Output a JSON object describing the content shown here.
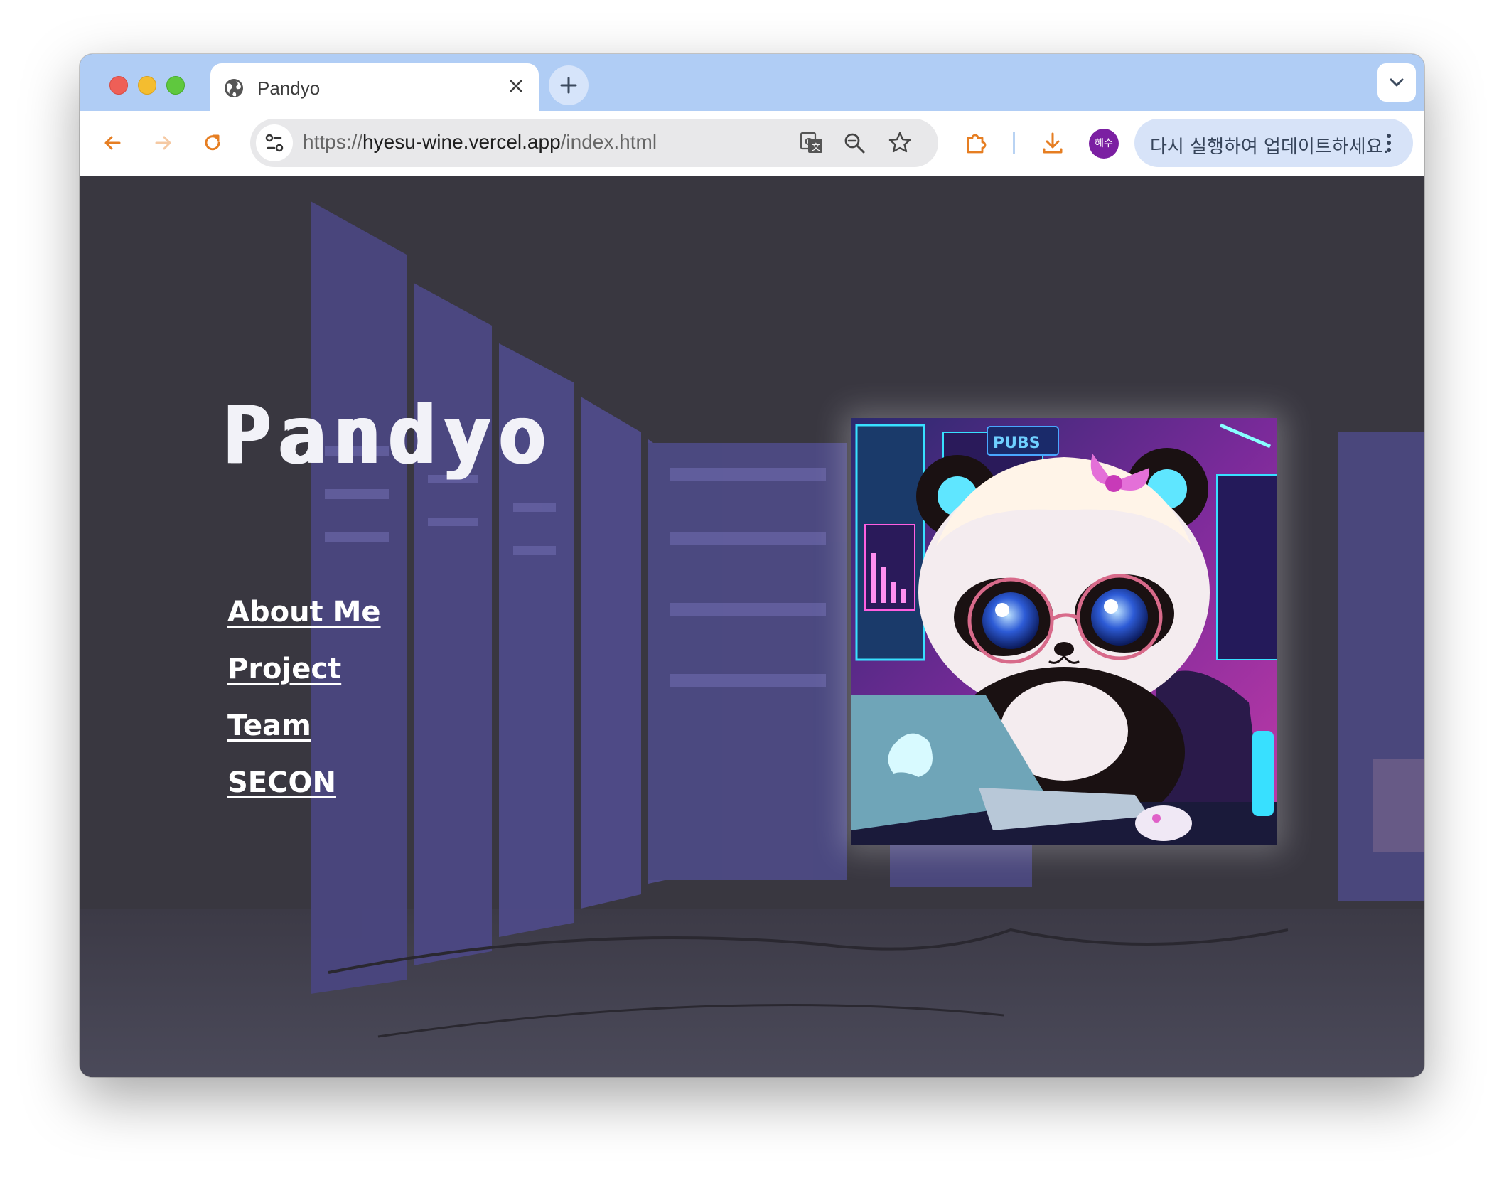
{
  "browser": {
    "tab": {
      "title": "Pandyo",
      "icon": "globe-icon"
    },
    "toolbar": {
      "url_scheme": "https://",
      "url_host": "hyesu-wine.vercel.app",
      "url_path": "/index.html",
      "avatar_label": "혜수",
      "update_button": "다시 실행하여 업데이트하세요."
    },
    "colors": {
      "tabstrip": "#b0cdf5",
      "accent": "#e67e22",
      "avatar": "#7b1fa2"
    }
  },
  "page": {
    "title": "Pandyo",
    "nav": [
      {
        "label": "About Me"
      },
      {
        "label": "Project"
      },
      {
        "label": "Team"
      },
      {
        "label": "SECON"
      }
    ],
    "hero_sign": "PUBS"
  }
}
